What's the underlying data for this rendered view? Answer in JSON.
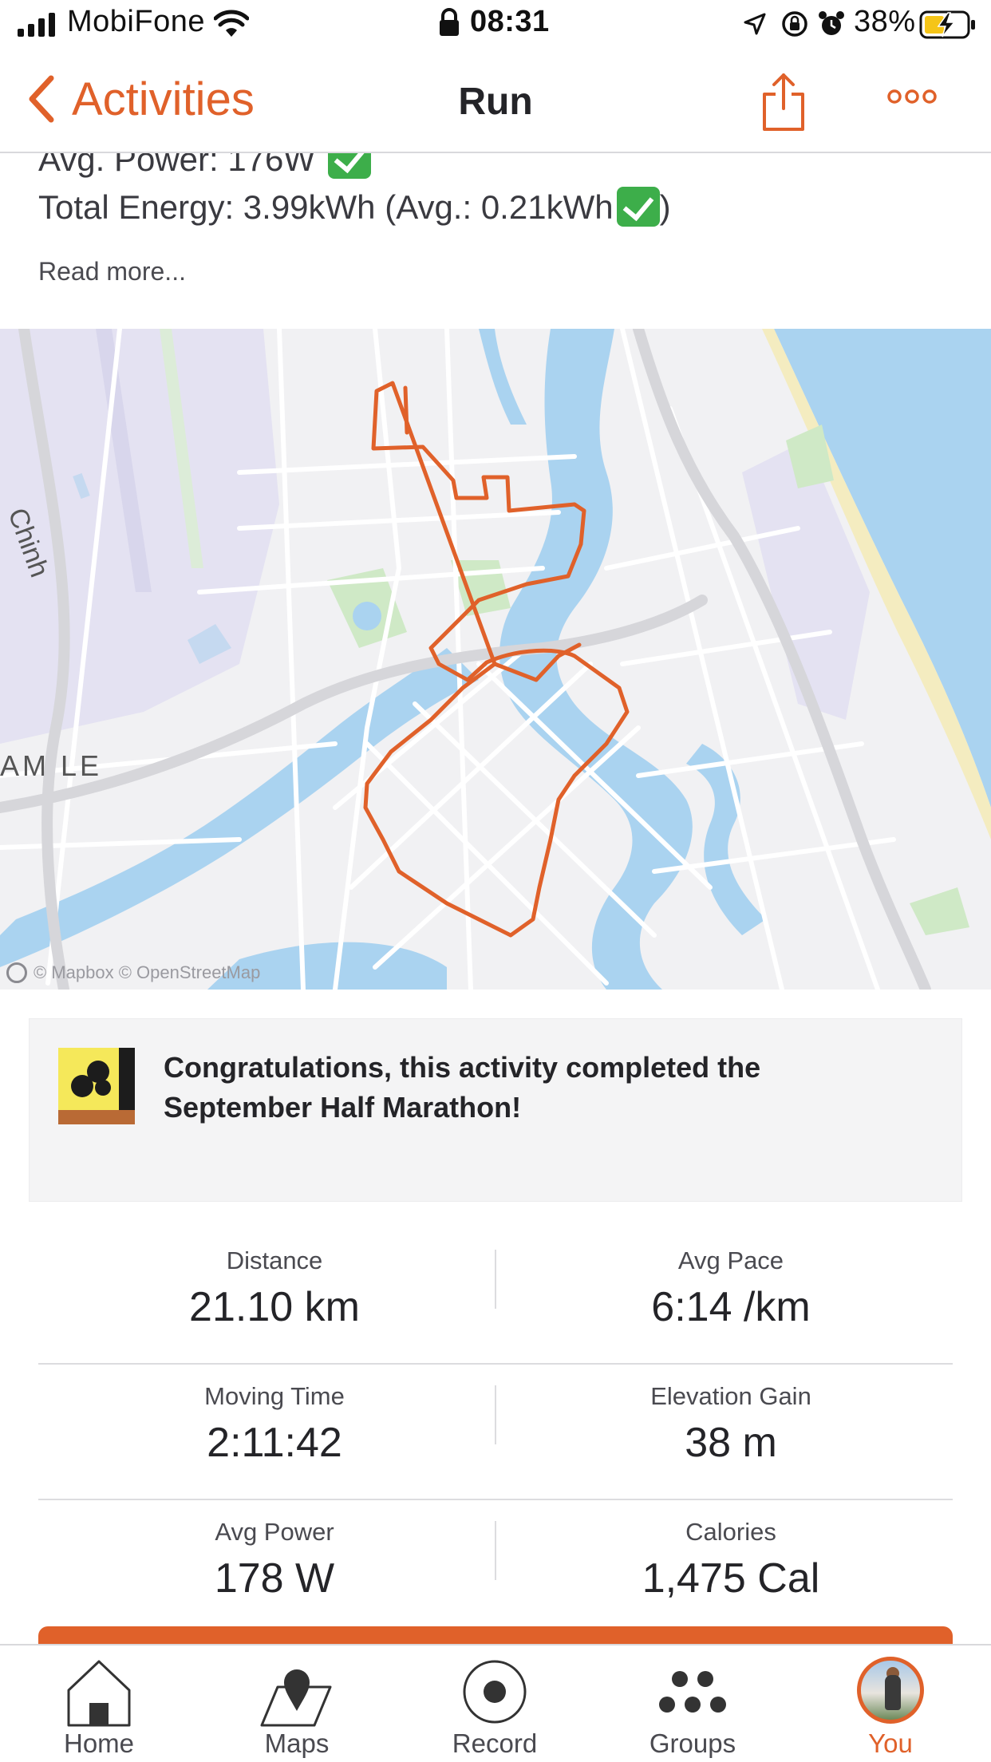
{
  "status_bar": {
    "carrier": "MobiFone",
    "time": "08:31",
    "battery_percent": "38%"
  },
  "nav": {
    "back_label": "Activities",
    "title": "Run"
  },
  "description": {
    "line_partial": "Avg. Power: 176W",
    "line_energy": "Total Energy: 3.99kWh (Avg.: 0.21kWh",
    "line_energy_close": ")",
    "read_more": "Read more..."
  },
  "map": {
    "labels": {
      "road_label": "Chinh",
      "district_label": "AM LE"
    },
    "attribution": "© Mapbox © OpenStreetMap",
    "route_color": "#e0612a",
    "water_color": "#aad3f0"
  },
  "challenge": {
    "text": "Congratulations, this activity completed the September Half Marathon!",
    "badge_colors": {
      "background": "#f5e85a",
      "strip": "#1c1c1c"
    }
  },
  "stats": [
    {
      "left_label": "Distance",
      "left_value": "21.10 km",
      "right_label": "Avg Pace",
      "right_value": "6:14 /km"
    },
    {
      "left_label": "Moving Time",
      "left_value": "2:11:42",
      "right_label": "Elevation Gain",
      "right_value": "38 m"
    },
    {
      "left_label": "Avg Power",
      "left_value": "178 W",
      "right_label": "Calories",
      "right_value": "1,475 Cal"
    }
  ],
  "tabs": [
    {
      "label": "Home",
      "icon": "home-icon",
      "active": false
    },
    {
      "label": "Maps",
      "icon": "maps-icon",
      "active": false
    },
    {
      "label": "Record",
      "icon": "record-icon",
      "active": false
    },
    {
      "label": "Groups",
      "icon": "groups-icon",
      "active": false
    },
    {
      "label": "You",
      "icon": "avatar",
      "active": true
    }
  ],
  "colors": {
    "accent": "#e0612a",
    "text_primary": "#242428",
    "check_green": "#3dae4a"
  }
}
